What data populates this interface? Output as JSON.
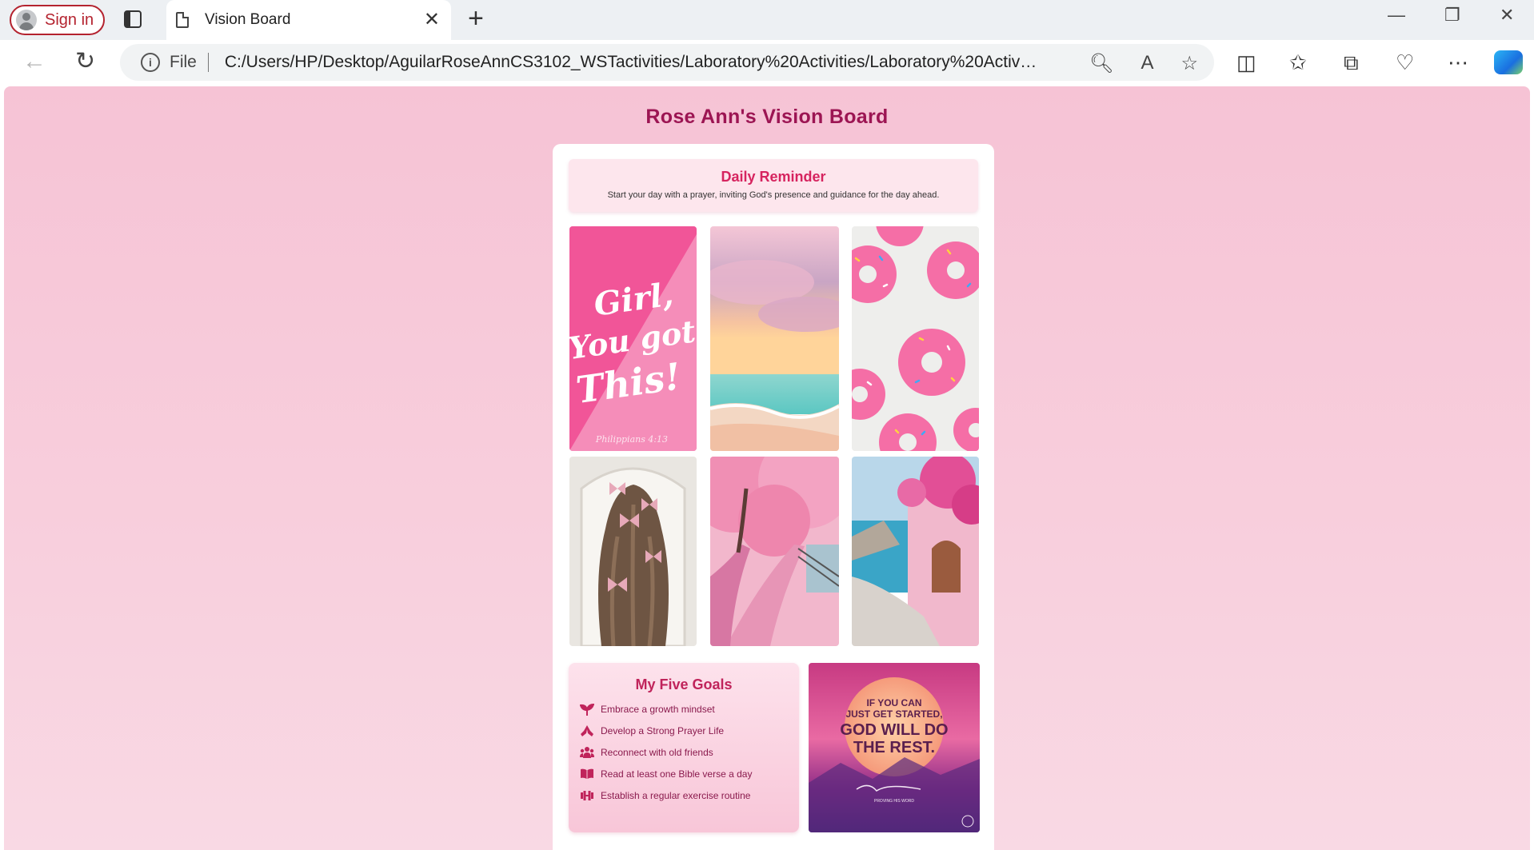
{
  "browser": {
    "sign_in_label": "Sign in",
    "tab_title": "Vision Board",
    "file_label": "File",
    "url": "C:/Users/HP/Desktop/AguilarRoseAnnCS3102_WSTactivities/Laboratory%20Activities/Laboratory%20Activity%..."
  },
  "page": {
    "title": "Rose Ann's Vision Board",
    "reminder": {
      "title": "Daily Reminder",
      "text": "Start your day with a prayer, inviting God's presence and guidance for the day ahead."
    },
    "photos": [
      {
        "name": "girl-you-got-this-image",
        "lines": [
          "Girl,",
          "You got",
          "This!"
        ],
        "caption": "Philippians 4:13"
      },
      {
        "name": "pink-sunset-beach-image"
      },
      {
        "name": "pink-donuts-image"
      },
      {
        "name": "hair-bows-image"
      },
      {
        "name": "cherry-blossom-path-image"
      },
      {
        "name": "pink-seaside-house-image"
      }
    ],
    "goals": {
      "title": "My Five Goals",
      "items": [
        {
          "icon": "seedling-icon",
          "label": "Embrace a growth mindset"
        },
        {
          "icon": "praying-hands-icon",
          "label": "Develop a Strong Prayer Life"
        },
        {
          "icon": "people-group-icon",
          "label": "Reconnect with old friends"
        },
        {
          "icon": "open-book-icon",
          "label": "Read at least one Bible verse a day"
        },
        {
          "icon": "dumbbell-icon",
          "label": "Establish a regular exercise routine"
        }
      ]
    },
    "quote": {
      "lines": [
        "IF YOU CAN",
        "JUST GET STARTED,",
        "GOD WILL DO",
        "THE REST."
      ],
      "subtitle": "PROVING HIS WORD"
    }
  },
  "colors": {
    "page_background": "#f7c7d8",
    "title": "#9c1553",
    "accent": "#d6245f",
    "goal_text": "#8a1a4d",
    "sign_in": "#b4232f"
  }
}
